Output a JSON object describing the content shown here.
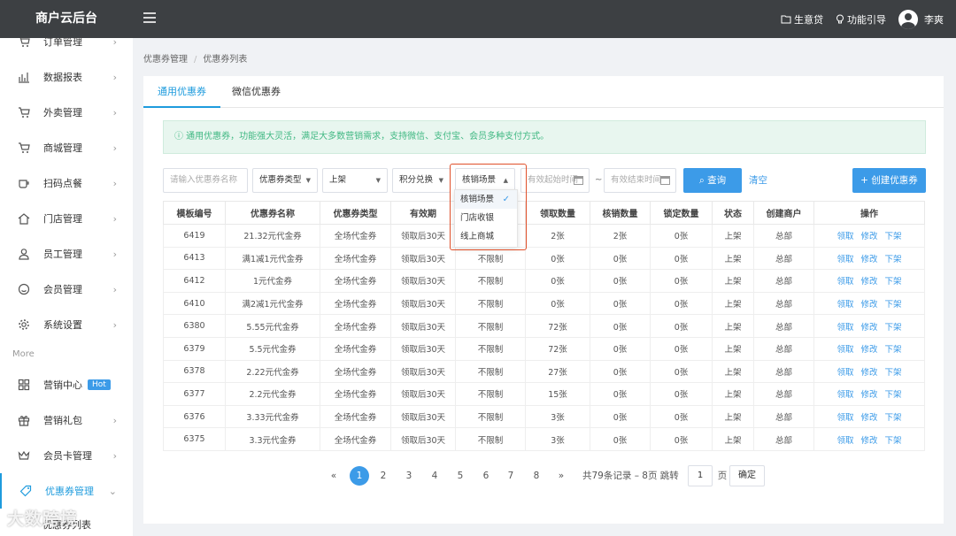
{
  "brand": "商户云后台",
  "topbar": {
    "items": [
      "生意贷",
      "功能引导"
    ],
    "user": "李爽"
  },
  "sidebar": {
    "items": [
      {
        "label": "订单管理",
        "icon": "cart-icon"
      },
      {
        "label": "数据报表",
        "icon": "chart-icon"
      },
      {
        "label": "外卖管理",
        "icon": "cart-icon"
      },
      {
        "label": "商城管理",
        "icon": "cart-icon"
      },
      {
        "label": "扫码点餐",
        "icon": "cup-icon"
      },
      {
        "label": "门店管理",
        "icon": "home-icon"
      },
      {
        "label": "员工管理",
        "icon": "user-icon"
      },
      {
        "label": "会员管理",
        "icon": "smile-icon"
      },
      {
        "label": "系统设置",
        "icon": "gear-icon"
      }
    ],
    "more_label": "More",
    "more_items": [
      {
        "label": "营销中心",
        "icon": "grid-icon",
        "badge": "Hot"
      },
      {
        "label": "营销礼包",
        "icon": "gift-icon"
      },
      {
        "label": "会员卡管理",
        "icon": "crown-icon"
      },
      {
        "label": "优惠券管理",
        "icon": "tag-icon"
      }
    ],
    "sub_item": "优惠券列表"
  },
  "breadcrumb": [
    "优惠券管理",
    "优惠券列表"
  ],
  "tabs": [
    "通用优惠券",
    "微信优惠券"
  ],
  "alert": "ⓘ 通用优惠券，功能强大灵活，满足大多数营销需求，支持微信、支付宝、会员多种支付方式。",
  "filters": {
    "name_placeholder": "请输入优惠券名称",
    "type": "优惠券类型",
    "status": "上架",
    "exchange": "积分兑换",
    "scene": "核销场景",
    "start_placeholder": "有效起始时间",
    "end_placeholder": "有效结束时间",
    "tilde": "~",
    "search": "查询",
    "clear": "清空",
    "create": "+ 创建优惠券"
  },
  "scene_options": [
    "核销场景",
    "门店收银",
    "线上商城"
  ],
  "table": {
    "headers": [
      "模板编号",
      "优惠券名称",
      "优惠券类型",
      "有效期",
      "",
      "领取数量",
      "核销数量",
      "锁定数量",
      "状态",
      "创建商户",
      "操作"
    ],
    "ops": [
      "领取",
      "修改",
      "下架"
    ],
    "rows": [
      [
        "6419",
        "21.32元代金券",
        "全场代金券",
        "领取后30天",
        "",
        "2张",
        "2张",
        "0张",
        "上架",
        "总部"
      ],
      [
        "6413",
        "满1减1元代金券",
        "全场代金券",
        "领取后30天",
        "不限制",
        "0张",
        "0张",
        "0张",
        "上架",
        "总部"
      ],
      [
        "6412",
        "1元代金券",
        "全场代金券",
        "领取后30天",
        "不限制",
        "0张",
        "0张",
        "0张",
        "上架",
        "总部"
      ],
      [
        "6410",
        "满2减1元代金券",
        "全场代金券",
        "领取后30天",
        "不限制",
        "0张",
        "0张",
        "0张",
        "上架",
        "总部"
      ],
      [
        "6380",
        "5.55元代金券",
        "全场代金券",
        "领取后30天",
        "不限制",
        "72张",
        "0张",
        "0张",
        "上架",
        "总部"
      ],
      [
        "6379",
        "5.5元代金券",
        "全场代金券",
        "领取后30天",
        "不限制",
        "72张",
        "0张",
        "0张",
        "上架",
        "总部"
      ],
      [
        "6378",
        "2.22元代金券",
        "全场代金券",
        "领取后30天",
        "不限制",
        "27张",
        "0张",
        "0张",
        "上架",
        "总部"
      ],
      [
        "6377",
        "2.2元代金券",
        "全场代金券",
        "领取后30天",
        "不限制",
        "15张",
        "0张",
        "0张",
        "上架",
        "总部"
      ],
      [
        "6376",
        "3.33元代金券",
        "全场代金券",
        "领取后30天",
        "不限制",
        "3张",
        "0张",
        "0张",
        "上架",
        "总部"
      ],
      [
        "6375",
        "3.3元代金券",
        "全场代金券",
        "领取后30天",
        "不限制",
        "3张",
        "0张",
        "0张",
        "上架",
        "总部"
      ]
    ]
  },
  "pagination": {
    "prev": "«",
    "next": "»",
    "pages": [
      "1",
      "2",
      "3",
      "4",
      "5",
      "6",
      "7",
      "8"
    ],
    "current": "1",
    "summary": "共79条记录 – 8页 跳转",
    "jump_value": "1",
    "page_unit": "页",
    "confirm": "确定"
  },
  "watermark": "大数跨境",
  "colors": {
    "accent": "#3c9be8",
    "topbar": "#3d4043",
    "highlight": "#e0502a",
    "alert_text": "#41b883"
  }
}
